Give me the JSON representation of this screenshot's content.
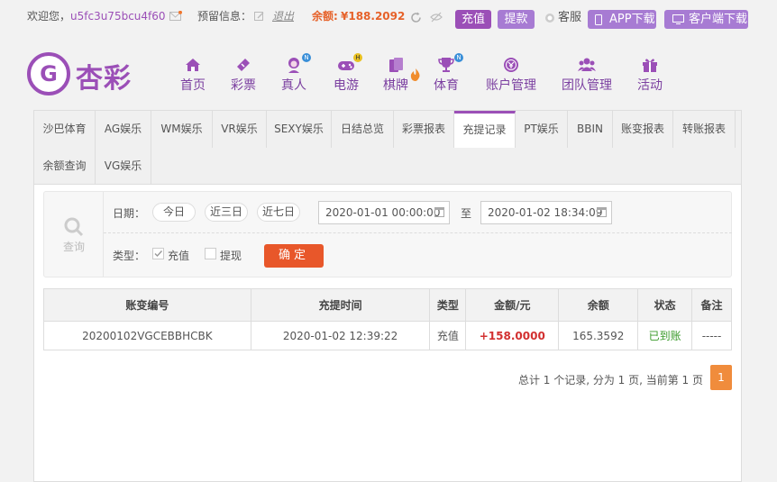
{
  "topbar": {
    "welcome": "欢迎您，",
    "username": "u5fc3u75bcu4f60",
    "reserved_label": "预留信息：",
    "logout": "退出",
    "balance_label": "余额: ",
    "balance_value": "¥188.2092",
    "deposit": "充值",
    "withdraw": "提款",
    "service": "客服",
    "app_download": "APP下载",
    "client_download": "客户端下载"
  },
  "logo": {
    "mark": "G",
    "text": "杏彩"
  },
  "nav": [
    {
      "label": "首页",
      "icon": "home-icon"
    },
    {
      "label": "彩票",
      "icon": "ticket-icon"
    },
    {
      "label": "真人",
      "icon": "dealer-icon",
      "badge": "N"
    },
    {
      "label": "电游",
      "icon": "gamepad-icon",
      "badge": "H"
    },
    {
      "label": "棋牌",
      "icon": "cards-icon",
      "badge": "fire"
    },
    {
      "label": "体育",
      "icon": "trophy-icon",
      "badge": "N"
    },
    {
      "label": "账户管理",
      "icon": "coin-icon"
    },
    {
      "label": "团队管理",
      "icon": "team-icon"
    },
    {
      "label": "活动",
      "icon": "gift-icon"
    }
  ],
  "tabs": [
    "沙巴体育",
    "AG娱乐",
    "WM娱乐",
    "VR娱乐",
    "SEXY娱乐",
    "日结总览",
    "彩票报表",
    "充提记录",
    "PT娱乐",
    "BBIN",
    "账变报表",
    "转账报表",
    "余额查询",
    "VG娱乐"
  ],
  "active_tab": "充提记录",
  "filter": {
    "query_label": "查询",
    "date_label": "日期：",
    "quick": [
      "今日",
      "近三日",
      "近七日"
    ],
    "date_from": "2020-01-01 00:00:00",
    "to_label": "至",
    "date_to": "2020-01-02 18:34:09",
    "type_label": "类型：",
    "type_options": [
      {
        "label": "充值",
        "checked": true
      },
      {
        "label": "提现",
        "checked": false
      }
    ],
    "confirm": "确定"
  },
  "table": {
    "headers": [
      "账变编号",
      "充提时间",
      "类型",
      "金额/元",
      "余额",
      "状态",
      "备注"
    ],
    "rows": [
      {
        "id": "20200102VGCEBBHCBK",
        "time": "2020-01-02 12:39:22",
        "type": "充值",
        "amount": "+158.0000",
        "balance": "165.3592",
        "status": "已到账",
        "note": "-----"
      }
    ]
  },
  "pager": {
    "info": "总计 1 个记录, 分为 1 页, 当前第 1 页",
    "current": "1"
  },
  "colors": {
    "brand": "#9b4fb7",
    "accent": "#e8572a",
    "balance": "#e6622a",
    "pager": "#f08c3c"
  }
}
